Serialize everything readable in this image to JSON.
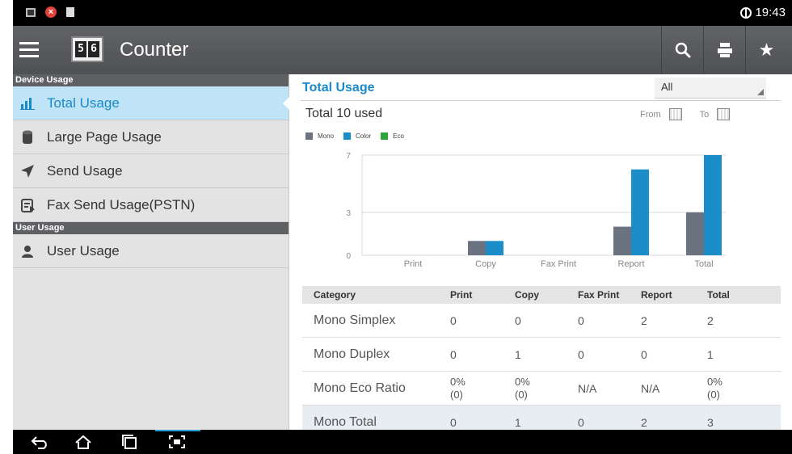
{
  "status_bar": {
    "time": "19:43"
  },
  "app_bar": {
    "title": "Counter",
    "counter_digits": [
      "5",
      "6"
    ]
  },
  "sidebar": {
    "device_section_label": "Device Usage",
    "device_items": [
      {
        "label": "Total Usage",
        "icon": "bar-chart-icon",
        "active": true
      },
      {
        "label": "Large Page Usage",
        "icon": "paper-roll-icon"
      },
      {
        "label": "Send Usage",
        "icon": "send-arrow-icon"
      },
      {
        "label": "Fax Send Usage(PSTN)",
        "icon": "fax-icon"
      }
    ],
    "user_section_label": "User Usage",
    "user_items": [
      {
        "label": "User Usage",
        "icon": "user-icon"
      }
    ]
  },
  "main": {
    "title": "Total Usage",
    "filter_value": "All",
    "total_used": "Total 10 used",
    "from_label": "From",
    "to_label": "To"
  },
  "chart_data": {
    "type": "bar",
    "categories": [
      "Print",
      "Copy",
      "Fax Print",
      "Report",
      "Total"
    ],
    "series": [
      {
        "name": "Mono",
        "color": "#6b7280",
        "values": [
          0,
          1,
          0,
          2,
          3
        ]
      },
      {
        "name": "Color",
        "color": "#1b8ec9",
        "values": [
          0,
          1,
          0,
          6,
          7
        ]
      },
      {
        "name": "Eco",
        "color": "#2ea63a",
        "values": [
          0,
          0,
          0,
          0,
          0
        ]
      }
    ],
    "yticks": [
      0,
      3,
      7
    ],
    "ylim": [
      0,
      7
    ]
  },
  "table": {
    "headers": [
      "Category",
      "Print",
      "Copy",
      "Fax Print",
      "Report",
      "Total"
    ],
    "rows": [
      [
        "Mono Simplex",
        "0",
        "0",
        "0",
        "2",
        "2"
      ],
      [
        "Mono Duplex",
        "0",
        "1",
        "0",
        "0",
        "1"
      ],
      [
        "Mono Eco Ratio",
        "0%\n(0)",
        "0%\n(0)",
        "N/A",
        "N/A",
        "0%\n(0)"
      ],
      [
        "Mono Total",
        "0",
        "1",
        "0",
        "2",
        "3"
      ]
    ]
  }
}
